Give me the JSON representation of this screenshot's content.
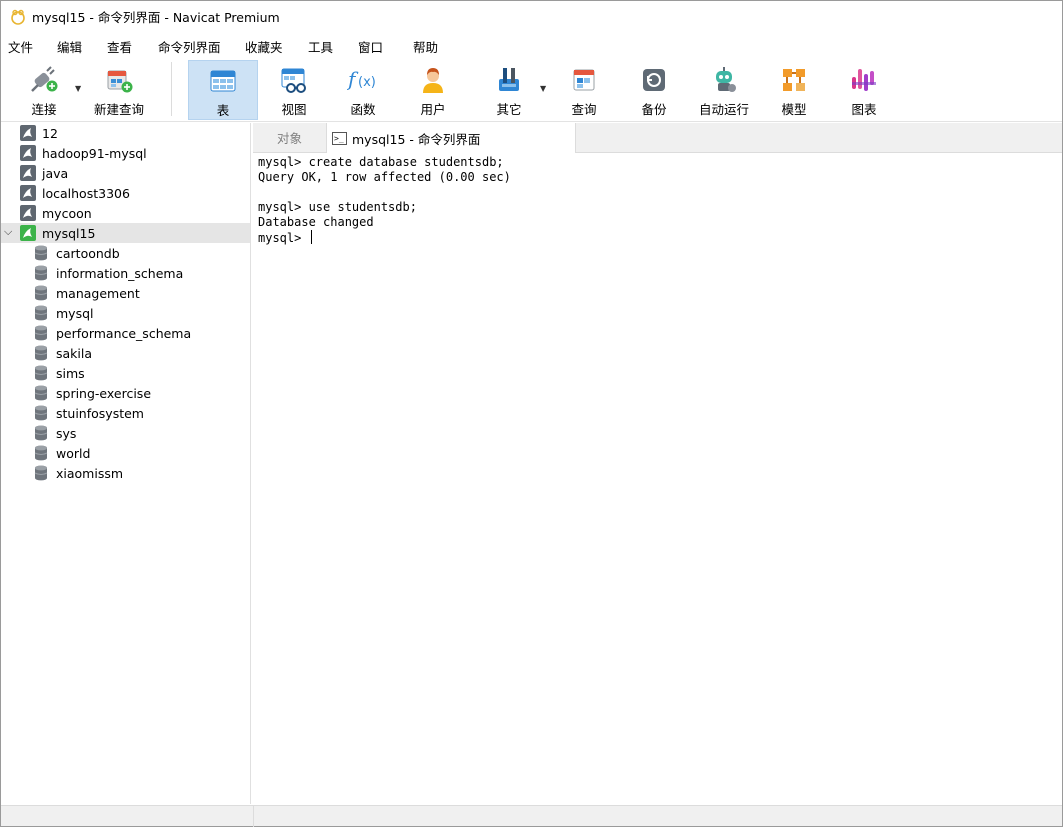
{
  "window": {
    "title": "mysql15 - 命令列界面 - Navicat Premium"
  },
  "menu": [
    "文件",
    "编辑",
    "查看",
    "命令列界面",
    "收藏夹",
    "工具",
    "窗口",
    "帮助"
  ],
  "toolbar": {
    "connect": "连接",
    "new_query": "新建查询",
    "table": "表",
    "view": "视图",
    "function": "函数",
    "user": "用户",
    "other": "其它",
    "query": "查询",
    "backup": "备份",
    "automation": "自动运行",
    "model": "模型",
    "chart": "图表"
  },
  "connections": [
    "12",
    "hadoop91-mysql",
    "java",
    "localhost3306",
    "mycoon",
    "mysql15"
  ],
  "databases": [
    "cartoondb",
    "information_schema",
    "management",
    "mysql",
    "performance_schema",
    "sakila",
    "sims",
    "spring-exercise",
    "stuinfosystem",
    "sys",
    "world",
    "xiaomissm"
  ],
  "tabs": {
    "objects": "对象",
    "console": "mysql15 - 命令列界面",
    "console_icon_text": ">_"
  },
  "console": {
    "lines": [
      "mysql> create database studentsdb;",
      "Query OK, 1 row affected (0.00 sec)",
      "",
      "mysql> use studentsdb;",
      "Database changed",
      "mysql> "
    ]
  },
  "colors": {
    "selected_tool_bg": "#cde2f5",
    "selected_row_bg": "#e5e5e5",
    "active_connection": "#3cb34a"
  },
  "icons": {
    "app": "navicat-logo-icon",
    "connection": "mysql-dolphin-icon",
    "database": "database-cylinder-icon"
  }
}
